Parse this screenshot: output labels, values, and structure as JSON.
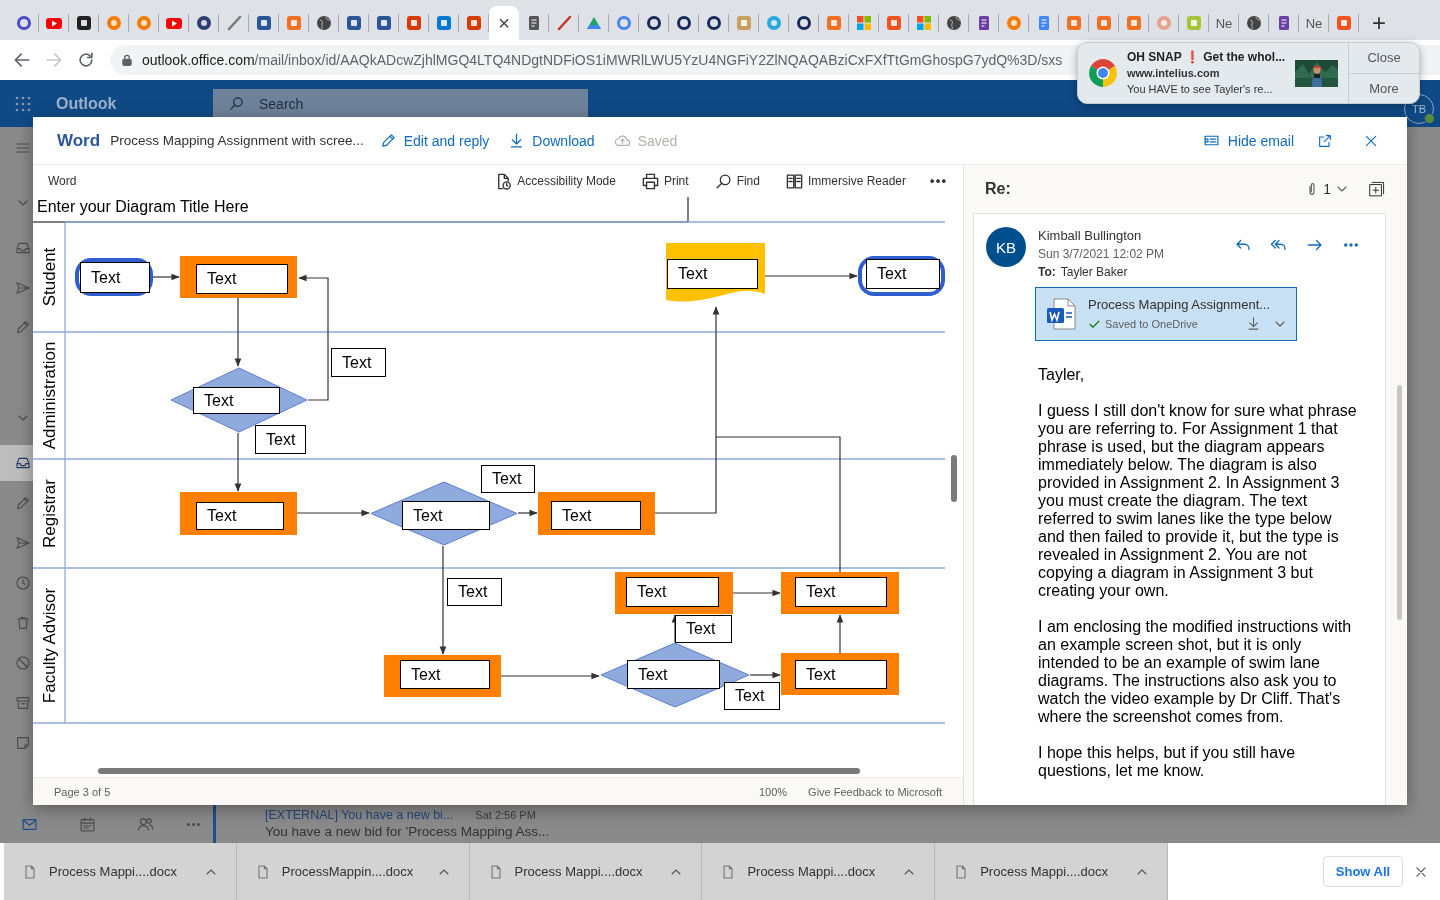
{
  "browser_tabs": [
    {
      "kind": "ring",
      "color": "#4b4bc6",
      "selected": false
    },
    {
      "kind": "play",
      "color": "#ff0000",
      "selected": false
    },
    {
      "kind": "square",
      "color": "#222222",
      "selected": false
    },
    {
      "kind": "circle",
      "color": "#f57c00",
      "selected": false
    },
    {
      "kind": "circle",
      "color": "#f57c00",
      "selected": false
    },
    {
      "kind": "play",
      "color": "#ff0000",
      "selected": false
    },
    {
      "kind": "circle",
      "color": "#2c3e70",
      "selected": false
    },
    {
      "kind": "stroke",
      "color": "#777777",
      "selected": false
    },
    {
      "kind": "square",
      "color": "#2b579a",
      "selected": false
    },
    {
      "kind": "square",
      "color": "#f36f21",
      "selected": false
    },
    {
      "kind": "globe",
      "color": "#444444",
      "selected": false
    },
    {
      "kind": "square",
      "color": "#2b579a",
      "selected": false
    },
    {
      "kind": "square",
      "color": "#2b579a",
      "selected": false
    },
    {
      "kind": "square",
      "color": "#d83b01",
      "selected": false
    },
    {
      "kind": "square",
      "color": "#0078d4",
      "selected": false
    },
    {
      "kind": "square",
      "color": "#d83b01",
      "selected": false
    },
    {
      "kind": "close",
      "color": "#444444",
      "label": "×",
      "selected": true
    },
    {
      "kind": "doc",
      "color": "#555555",
      "selected": false
    },
    {
      "kind": "stroke",
      "color": "#c0392b",
      "selected": false
    },
    {
      "kind": "triangle",
      "color": "#1fa463",
      "selected": false
    },
    {
      "kind": "ring",
      "color": "#4285f4",
      "selected": false
    },
    {
      "kind": "ring",
      "color": "#1a2a5a",
      "selected": false
    },
    {
      "kind": "ring",
      "color": "#1a2a5a",
      "selected": false
    },
    {
      "kind": "ring",
      "color": "#1a2a5a",
      "selected": false
    },
    {
      "kind": "square",
      "color": "#c8a060",
      "selected": false
    },
    {
      "kind": "circle",
      "color": "#2aa7e0",
      "selected": false
    },
    {
      "kind": "ring",
      "color": "#1a2a5a",
      "selected": false
    },
    {
      "kind": "square",
      "color": "#f36f21",
      "selected": false
    },
    {
      "kind": "grid",
      "color": "#f25022",
      "selected": false
    },
    {
      "kind": "square",
      "color": "#f4511e",
      "selected": false
    },
    {
      "kind": "grid",
      "color": "#f25022",
      "selected": false
    },
    {
      "kind": "globe",
      "color": "#444444",
      "selected": false
    },
    {
      "kind": "doc",
      "color": "#6a3fa0",
      "selected": false
    },
    {
      "kind": "circle",
      "color": "#f57c00",
      "selected": false
    },
    {
      "kind": "doc",
      "color": "#4285f4",
      "selected": false
    },
    {
      "kind": "square",
      "color": "#f36f21",
      "selected": false
    },
    {
      "kind": "square",
      "color": "#f36f21",
      "selected": false
    },
    {
      "kind": "square",
      "color": "#f36f21",
      "selected": false
    },
    {
      "kind": "circle",
      "color": "#e8a090",
      "selected": false
    },
    {
      "kind": "square",
      "color": "#a4c639",
      "selected": false
    },
    {
      "kind": "text",
      "color": "#555555",
      "label": "Ne",
      "selected": false
    },
    {
      "kind": "globe",
      "color": "#444444",
      "selected": false
    },
    {
      "kind": "doc",
      "color": "#6a3fa0",
      "selected": false
    },
    {
      "kind": "text",
      "color": "#555555",
      "label": "Ne",
      "selected": false
    },
    {
      "kind": "square",
      "color": "#f4511e",
      "selected": false
    }
  ],
  "new_tab": "+",
  "address_bar": {
    "back_disabled": false,
    "forward_disabled": true,
    "url_host": "outlook.office.com",
    "url_path": "/mail/inbox/id/AAQkADcwZjhlMGQ4LTQ4NDgtNDFiOS1iMWRlLWU5YzU4NGFiY2ZlNQAQABziCxFXfTtGmGhospG7ydQ%3D/sxs"
  },
  "notification": {
    "title": "OH SNAP ❗ Get the whol...",
    "site": "www.intelius.com",
    "message": "You HAVE to see Tayler's re...",
    "buttons": [
      "Close",
      "More"
    ]
  },
  "outlook": {
    "app_name": "Outlook",
    "search_placeholder": "Search",
    "avatar_initials": "TB",
    "folder_rail": [
      {
        "selected": false
      },
      {
        "selected": false
      },
      {
        "selected": false
      },
      {
        "selected": false
      },
      {
        "selected": false
      },
      {
        "selected": false
      },
      {
        "selected": true
      },
      {
        "selected": false
      },
      {
        "selected": false
      },
      {
        "selected": false
      },
      {
        "selected": false
      },
      {
        "selected": false
      },
      {
        "selected": false
      },
      {
        "selected": false
      }
    ],
    "bottom_nav": [
      {
        "selected": true
      },
      {
        "selected": false
      },
      {
        "selected": false
      },
      {
        "selected": false
      }
    ],
    "message_preview": {
      "subject": "[EXTERNAL] You have a new bi...",
      "time": "Sat 2:56 PM",
      "snippet": "You have a new bid for 'Process Mapping Ass..."
    }
  },
  "word_viewer": {
    "app": "Word",
    "file_name": "Process Mapping Assignment with scree...",
    "actions": [
      {
        "label": "Edit and reply",
        "disabled": false
      },
      {
        "label": "Download",
        "disabled": false
      },
      {
        "label": "Saved",
        "disabled": true
      }
    ],
    "hide_email": "Hide email",
    "toolbar_label": "Word",
    "toolbar": [
      {
        "label": "Accessibility Mode"
      },
      {
        "label": "Print"
      },
      {
        "label": "Find"
      },
      {
        "label": "Immersive Reader"
      }
    ],
    "page_status": "Page 3 of 5",
    "zoom": "100%",
    "feedback": "Give Feedback to Microsoft"
  },
  "diagram": {
    "title": "Enter your Diagram Title Here",
    "lanes": [
      "Student",
      "Administration",
      "Registrar",
      "Faculty Advisor"
    ],
    "nodes": [
      {
        "kind": "terminator",
        "text": "Text"
      },
      {
        "kind": "process",
        "text": "Text"
      },
      {
        "kind": "document",
        "text": "Text"
      },
      {
        "kind": "terminator",
        "text": "Text"
      },
      {
        "kind": "decision",
        "text": "Text"
      },
      {
        "kind": "label",
        "text": "Text"
      },
      {
        "kind": "label",
        "text": "Text"
      },
      {
        "kind": "process",
        "text": "Text"
      },
      {
        "kind": "decision",
        "text": "Text"
      },
      {
        "kind": "label",
        "text": "Text"
      },
      {
        "kind": "process",
        "text": "Text"
      },
      {
        "kind": "label",
        "text": "Text"
      },
      {
        "kind": "process",
        "text": "Text"
      },
      {
        "kind": "process",
        "text": "Text"
      },
      {
        "kind": "label",
        "text": "Text"
      },
      {
        "kind": "process",
        "text": "Text"
      },
      {
        "kind": "decision",
        "text": "Text"
      },
      {
        "kind": "label",
        "text": "Text"
      },
      {
        "kind": "process",
        "text": "Text"
      }
    ]
  },
  "email": {
    "subject": "Re:",
    "attachment_count": "1",
    "initials": "KB",
    "sender": "Kimball Bullington",
    "date": "Sun 3/7/2021 12:02 PM",
    "to_label": "To:",
    "to": "Tayler Baker",
    "attachment": {
      "name": "Process Mapping Assignment...",
      "status": "Saved to OneDrive"
    },
    "body": [
      "Tayler,",
      "I guess I still don't know for sure what phrase you are referring to. For Assignment 1 that phrase is used, but the diagram appears immediately below. The diagram is also provided in Assignment 2. In Assignment 3 you must create the diagram. The text referred to swim lanes like the type below and then failed to provide it, but the type is revealed in Assignment 2. You are not copying a diagram in Assignment 3 but creating your own.",
      "I am enclosing the modified instructions with an example screen shot, but it is only intended to be an example of swim lane diagrams. The instructions also ask you to watch the video example by Dr Cliff. That's where the screenshot comes from.",
      "I hope this helps, but if you still have questions, let me know."
    ]
  },
  "downloads": {
    "items": [
      {
        "name": "Process Mappi....docx"
      },
      {
        "name": "ProcessMappin....docx"
      },
      {
        "name": "Process Mappi....docx"
      },
      {
        "name": "Process Mappi....docx"
      },
      {
        "name": "Process Mappi....docx"
      }
    ],
    "show_all": "Show All"
  }
}
